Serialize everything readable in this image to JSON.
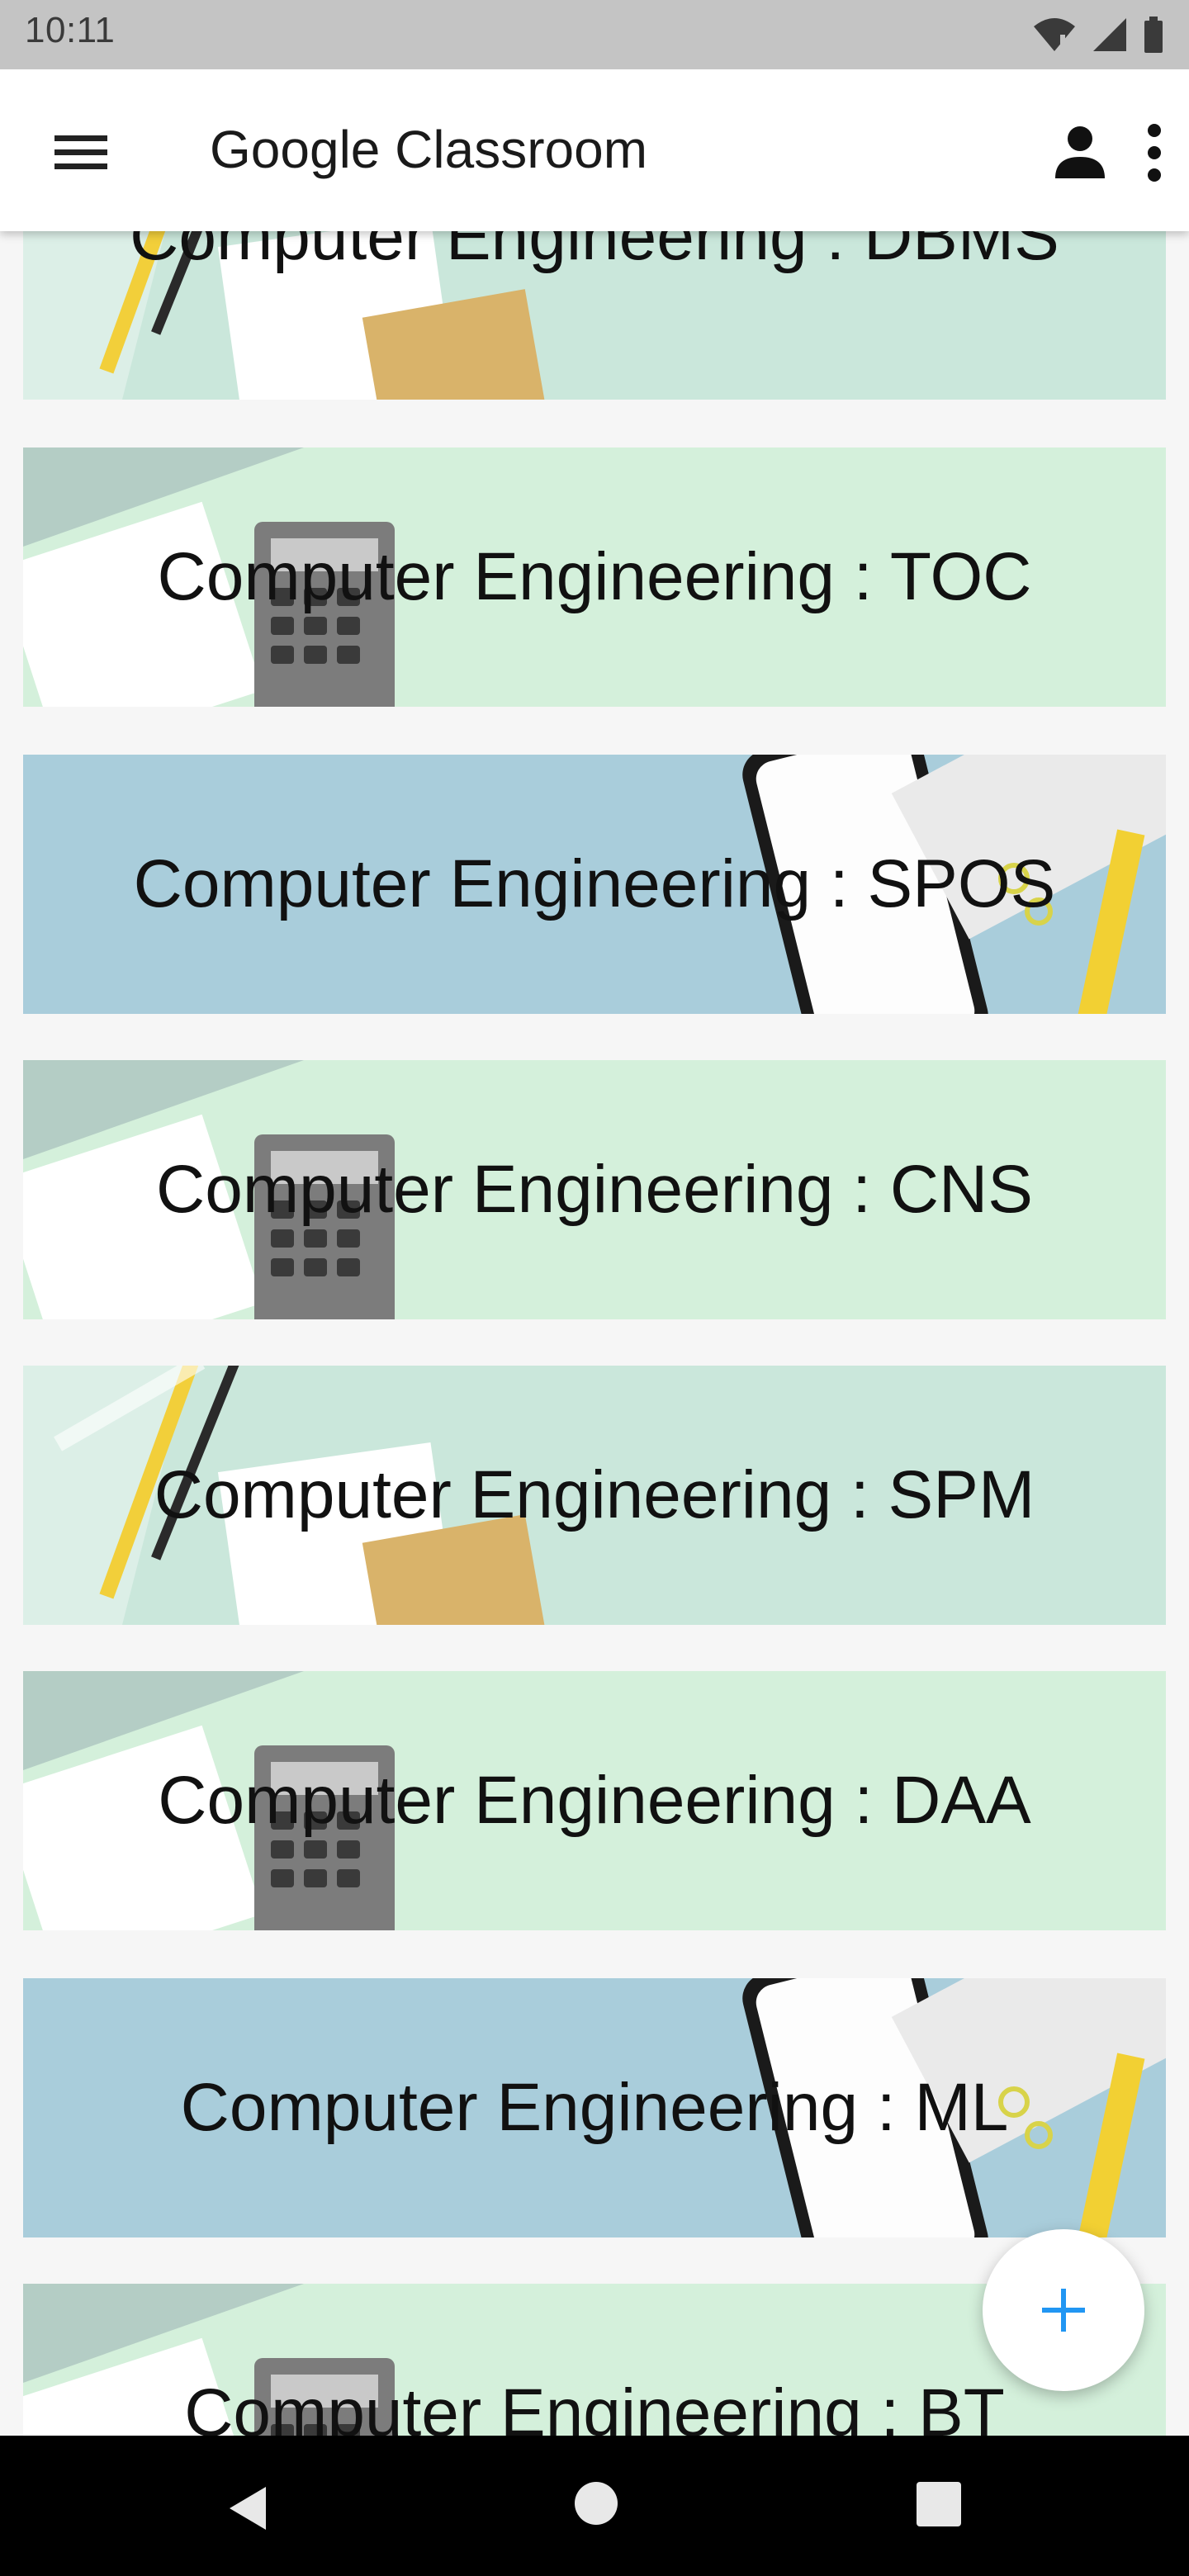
{
  "status_bar": {
    "time": "10:11"
  },
  "app_bar": {
    "title": "Google Classroom"
  },
  "classes": [
    {
      "title": "Computer Engineering : DBMS",
      "theme": "green-desk"
    },
    {
      "title": "Computer Engineering : TOC",
      "theme": "calculator"
    },
    {
      "title": "Computer Engineering : SPOS",
      "theme": "blue-phone"
    },
    {
      "title": "Computer Engineering : CNS",
      "theme": "calculator"
    },
    {
      "title": "Computer Engineering : SPM",
      "theme": "green-desk"
    },
    {
      "title": "Computer Engineering : DAA",
      "theme": "calculator"
    },
    {
      "title": "Computer Engineering : ML",
      "theme": "blue-phone"
    },
    {
      "title": "Computer Engineering : BT",
      "theme": "calculator"
    }
  ],
  "colors": {
    "accent": "#2196f3",
    "green_desk": "#b9dccf",
    "calculator": "#d4f0db",
    "blue_phone": "#a9cddb"
  }
}
